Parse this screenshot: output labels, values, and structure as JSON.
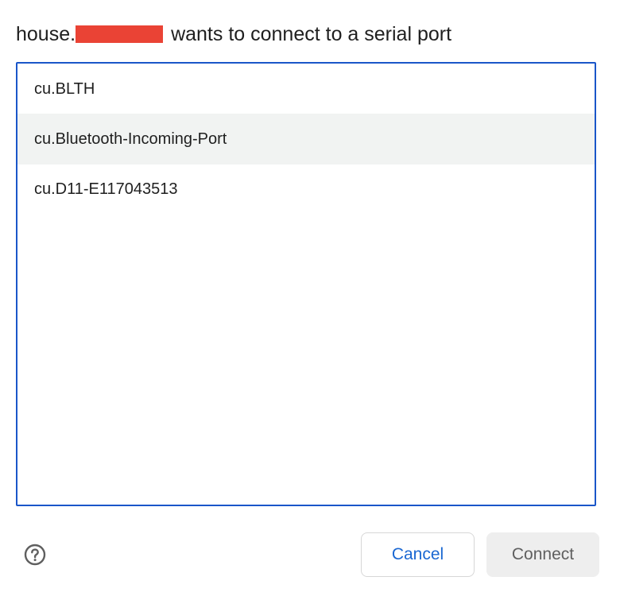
{
  "dialog": {
    "title_prefix": "house.",
    "title_suffix": "wants to connect to a serial port"
  },
  "ports": [
    {
      "label": "cu.BLTH"
    },
    {
      "label": "cu.Bluetooth-Incoming-Port"
    },
    {
      "label": "cu.D11-E117043513"
    }
  ],
  "buttons": {
    "cancel": "Cancel",
    "connect": "Connect"
  },
  "icons": {
    "help": "help-circle-icon"
  },
  "colors": {
    "accent": "#1a67d2",
    "focus_border": "#1a56c9",
    "hover_row": "#f1f3f2",
    "redaction": "#ea4335",
    "disabled_button": "#eeeeee"
  }
}
